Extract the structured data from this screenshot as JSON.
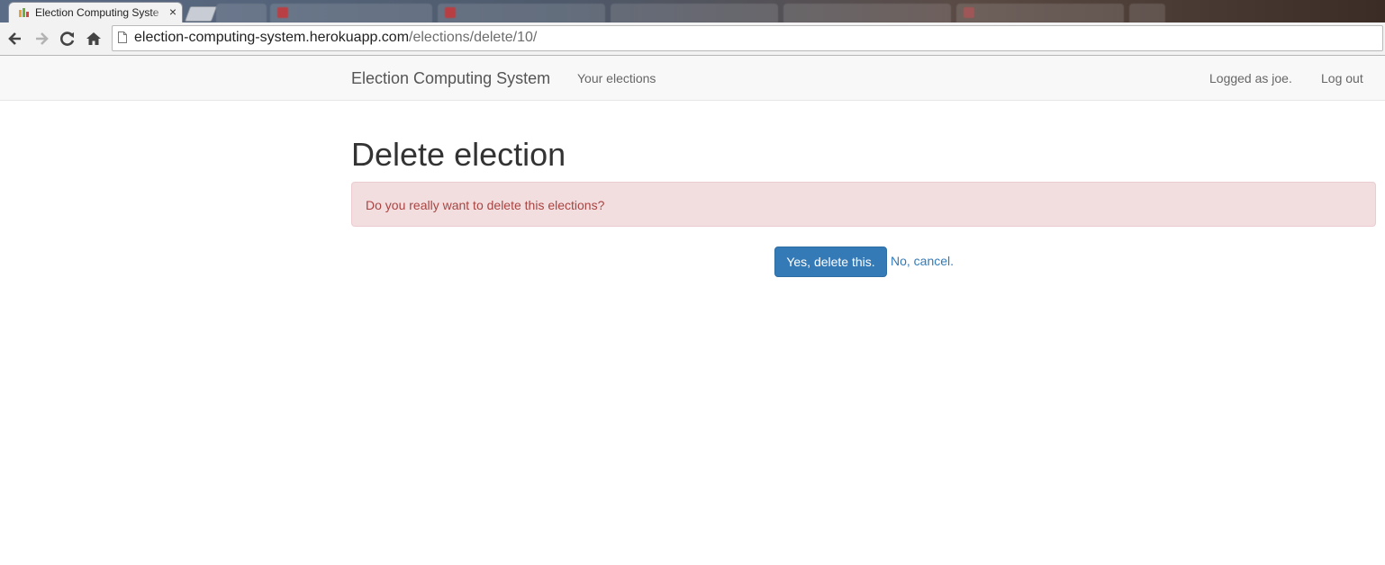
{
  "browser": {
    "active_tab_title": "Election Computing Syste",
    "tab_close": "×",
    "url_host": "election-computing-system.herokuapp.com",
    "url_path": "/elections/delete/10/"
  },
  "navbar": {
    "brand": "Election Computing System",
    "your_elections": "Your elections",
    "logged_as": "Logged as joe.",
    "log_out": "Log out"
  },
  "main": {
    "title": "Delete election",
    "alert_text": "Do you really want to delete this elections?",
    "confirm_button": "Yes, delete this.",
    "cancel_link": "No, cancel."
  },
  "colors": {
    "primary": "#337ab7",
    "alert_bg": "#f2dede",
    "alert_text": "#a94442"
  }
}
